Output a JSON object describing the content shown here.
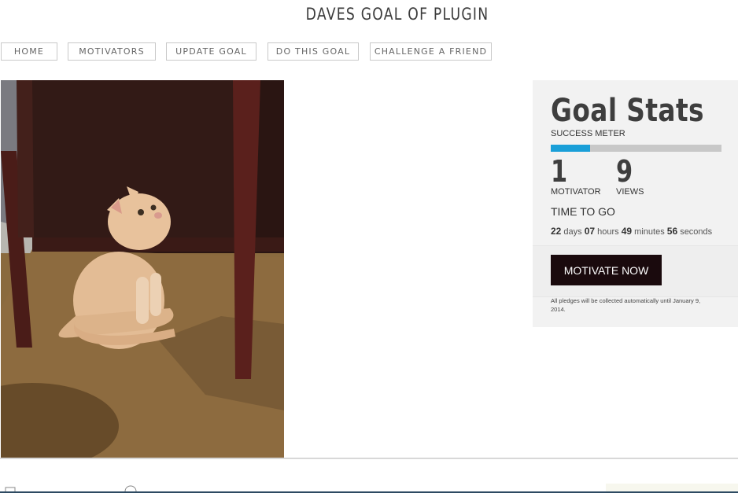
{
  "header": {
    "title": "DAVES GOAL OF PLUGIN"
  },
  "nav": {
    "items": [
      {
        "label": "HOME"
      },
      {
        "label": "MOTIVATORS"
      },
      {
        "label": "UPDATE GOAL"
      },
      {
        "label": "DO THIS GOAL"
      },
      {
        "label": "CHALLENGE A FRIEND"
      }
    ]
  },
  "stats": {
    "title": "Goal Stats",
    "meter_label": "SUCCESS METER",
    "meter_fraction": 0.23,
    "motivators_count": "1",
    "motivators_label": "MOTIVATOR",
    "views_count": "9",
    "views_label": "VIEWS",
    "time_to_go_label": "TIME TO GO",
    "countdown": {
      "days": "22",
      "days_label": "days",
      "hours": "07",
      "hours_label": "hours",
      "minutes": "49",
      "minutes_label": "minutes",
      "seconds": "56",
      "seconds_label": "seconds"
    },
    "cta_label": "MOTIVATE NOW",
    "note": "All pledges will be collected automatically until January 9, 2014."
  },
  "colors": {
    "meter_fill": "#1a9fd8",
    "cta_bg": "#1a0a0d"
  }
}
